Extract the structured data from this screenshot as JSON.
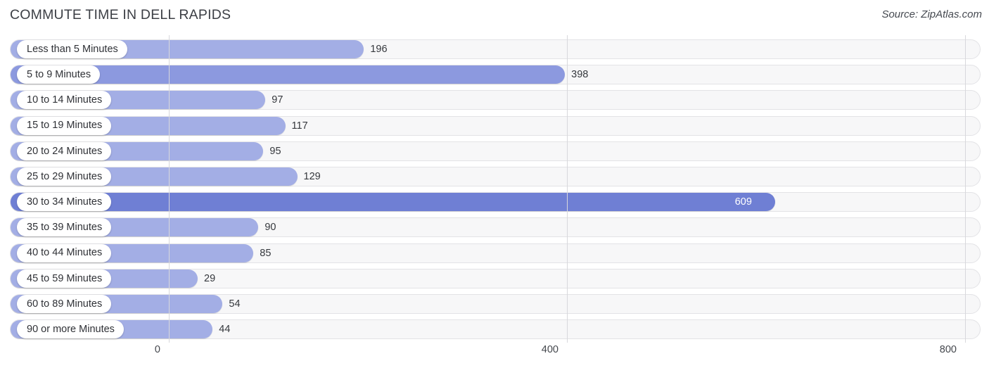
{
  "header": {
    "title": "COMMUTE TIME IN DELL RAPIDS",
    "source": "Source: ZipAtlas.com"
  },
  "axis": {
    "ticks": [
      "0",
      "400",
      "800"
    ]
  },
  "colors": {
    "bar_light": "#a3aee5",
    "bar_mid": "#8c99df",
    "bar_dark": "#6f7fd4",
    "track": "#f7f7f8",
    "track_border": "#e3e3e6",
    "gridline": "#d8d8dc",
    "title": "#3c3f45"
  },
  "chart_data": {
    "type": "bar",
    "orientation": "horizontal",
    "title": "COMMUTE TIME IN DELL RAPIDS",
    "subtitle": "Source: ZipAtlas.com",
    "xlabel": "",
    "ylabel": "",
    "xlim": [
      0,
      800
    ],
    "xticks": [
      0,
      400,
      800
    ],
    "grid": true,
    "legend": false,
    "categories": [
      "Less than 5 Minutes",
      "5 to 9 Minutes",
      "10 to 14 Minutes",
      "15 to 19 Minutes",
      "20 to 24 Minutes",
      "25 to 29 Minutes",
      "30 to 34 Minutes",
      "35 to 39 Minutes",
      "40 to 44 Minutes",
      "45 to 59 Minutes",
      "60 to 89 Minutes",
      "90 or more Minutes"
    ],
    "values": [
      196,
      398,
      97,
      117,
      95,
      129,
      609,
      90,
      85,
      29,
      54,
      44
    ],
    "rows": [
      {
        "label": "Less than 5 Minutes",
        "value": 196,
        "value_text": "196",
        "color": "#a3aee5",
        "inside": false
      },
      {
        "label": "5 to 9 Minutes",
        "value": 398,
        "value_text": "398",
        "color": "#8c99df",
        "inside": false
      },
      {
        "label": "10 to 14 Minutes",
        "value": 97,
        "value_text": "97",
        "color": "#a3aee5",
        "inside": false
      },
      {
        "label": "15 to 19 Minutes",
        "value": 117,
        "value_text": "117",
        "color": "#a3aee5",
        "inside": false
      },
      {
        "label": "20 to 24 Minutes",
        "value": 95,
        "value_text": "95",
        "color": "#a3aee5",
        "inside": false
      },
      {
        "label": "25 to 29 Minutes",
        "value": 129,
        "value_text": "129",
        "color": "#a3aee5",
        "inside": false
      },
      {
        "label": "30 to 34 Minutes",
        "value": 609,
        "value_text": "609",
        "color": "#6f7fd4",
        "inside": true
      },
      {
        "label": "35 to 39 Minutes",
        "value": 90,
        "value_text": "90",
        "color": "#a3aee5",
        "inside": false
      },
      {
        "label": "40 to 44 Minutes",
        "value": 85,
        "value_text": "85",
        "color": "#a3aee5",
        "inside": false
      },
      {
        "label": "45 to 59 Minutes",
        "value": 29,
        "value_text": "29",
        "color": "#a3aee5",
        "inside": false
      },
      {
        "label": "60 to 89 Minutes",
        "value": 54,
        "value_text": "54",
        "color": "#a3aee5",
        "inside": false
      },
      {
        "label": "90 or more Minutes",
        "value": 44,
        "value_text": "44",
        "color": "#a3aee5",
        "inside": false
      }
    ]
  }
}
